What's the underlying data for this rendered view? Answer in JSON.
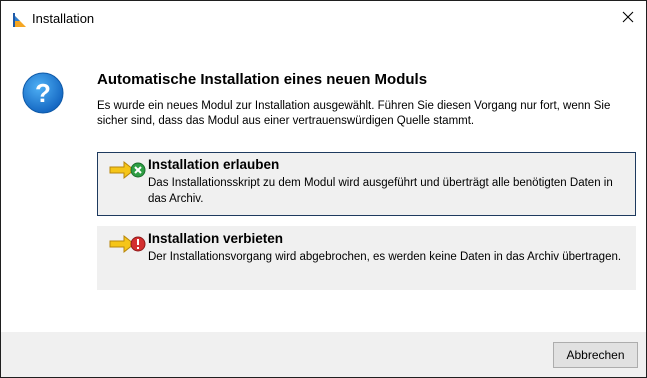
{
  "window": {
    "title": "Installation",
    "app_icon": "installation-app-icon",
    "close_glyph": "×"
  },
  "dialog": {
    "icon": "question-icon",
    "heading": "Automatische Installation eines neuen Moduls",
    "description": "Es wurde ein neues Modul zur Installation ausgewählt. Führen Sie diesen Vorgang nur fort, wenn Sie sicher sind, dass das Modul aus einer vertrauenswürdigen Quelle stammt."
  },
  "options": [
    {
      "title": "Installation erlauben",
      "description": "Das Installationsskript zu dem Modul wird ausgeführt und überträgt alle benötigten Daten in das Archiv.",
      "icon": "allow-arrow-check-icon",
      "selected": true
    },
    {
      "title": "Installation verbieten",
      "description": "Der Installationsvorgang wird abgebrochen, es werden keine Daten in das Archiv übertragen.",
      "icon": "deny-arrow-stop-icon",
      "selected": false
    }
  ],
  "footer": {
    "cancel_label": "Abbrechen"
  },
  "colors": {
    "accent_border": "#1e3a5f",
    "question_blue": "#1e88e5",
    "arrow_yellow": "#f5c518",
    "allow_green": "#2e9e44",
    "deny_red": "#d32f2f",
    "footer_bg": "#f0f0f0"
  }
}
